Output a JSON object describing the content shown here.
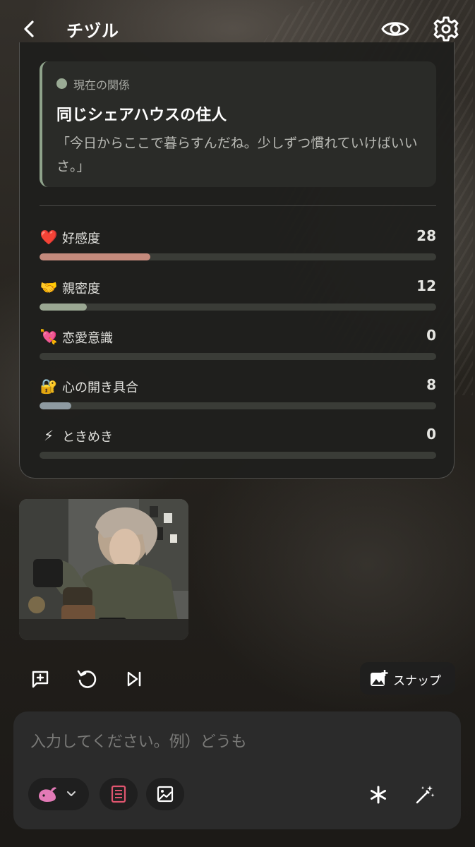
{
  "header": {
    "title": "チヅル",
    "icons": {
      "back": "chevron-left-icon",
      "preview": "eye-icon",
      "settings": "gear-icon"
    }
  },
  "relationship": {
    "label": "現在の関係",
    "title": "同じシェアハウスの住人",
    "quote": "「今日からここで暮らすんだね。少しずつ慣れていけばいいさ。」",
    "accent_color": "#8fa38b"
  },
  "stats": [
    {
      "emoji": "❤️",
      "label": "好感度",
      "value": "28",
      "level": 28,
      "color": "#c48a7c"
    },
    {
      "emoji": "🤝",
      "label": "親密度",
      "value": "12",
      "level": 12,
      "color": "#9aa792"
    },
    {
      "emoji": "💘",
      "label": "恋愛意識",
      "value": "0",
      "level": 0,
      "color": "#c48a7c"
    },
    {
      "emoji": "🔐",
      "label": "心の開き具合",
      "value": "8",
      "level": 8,
      "color": "#8e9aa1"
    },
    {
      "emoji": "⚡",
      "label": "ときめき",
      "value": "0",
      "level": 0,
      "color": "#c4b07c"
    }
  ],
  "actions": {
    "comment_icon": "add-comment-icon",
    "regenerate_icon": "refresh-icon",
    "skip_icon": "skip-next-icon",
    "snap_label": "スナップ",
    "snap_icon": "add-photo-icon"
  },
  "composer": {
    "placeholder": "入力してください。例）どうも",
    "model_icon": "whale-icon",
    "book_icon": "book-icon",
    "image_icon": "image-icon",
    "asterisk_icon": "asterisk-icon",
    "magic_icon": "magic-wand-icon",
    "book_color": "#e0556f"
  }
}
